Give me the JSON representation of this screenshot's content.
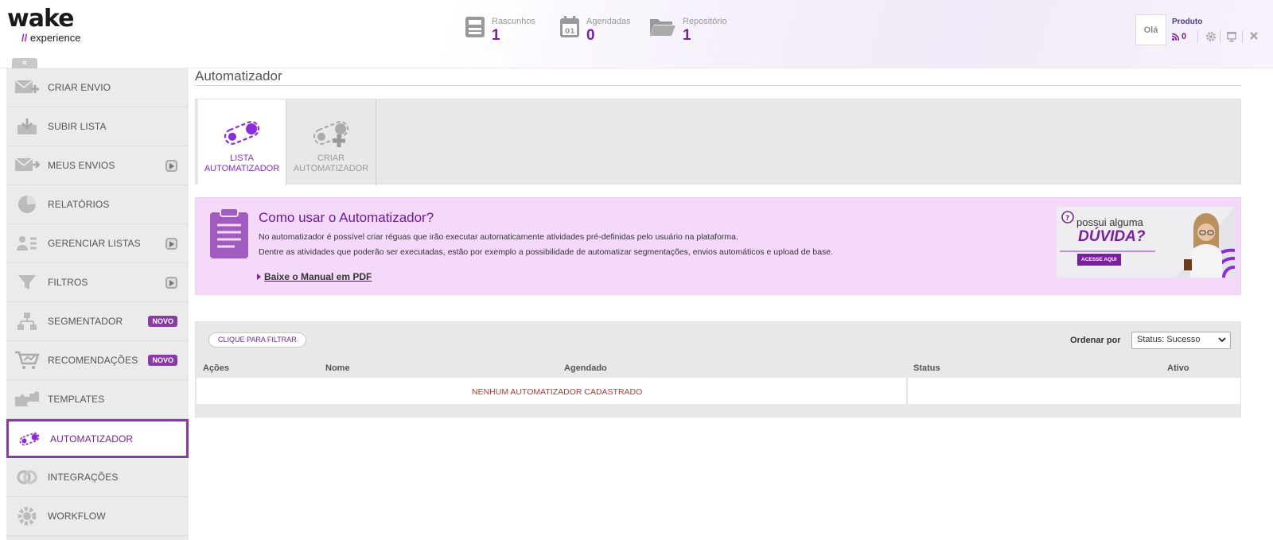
{
  "logo": {
    "word": "wake",
    "sub_slash": "//",
    "sub_text": "experience"
  },
  "header": {
    "stats": [
      {
        "label": "Rascunhos",
        "value": "1",
        "icon": "save-icon"
      },
      {
        "label": "Agendadas",
        "value": "0",
        "icon": "calendar-icon"
      },
      {
        "label": "Repositório",
        "value": "1",
        "icon": "folder-icon"
      }
    ],
    "greeting": "Olá",
    "product_label": "Produto",
    "rss_count": "0"
  },
  "sidebar": {
    "collapse_label": "«",
    "items": [
      {
        "label": "CRIAR ENVIO",
        "icon": "send-plus-icon"
      },
      {
        "label": "SUBIR LISTA",
        "icon": "upload-list-icon"
      },
      {
        "label": "MEUS ENVIOS",
        "icon": "my-sends-icon"
      },
      {
        "label": "RELATÓRIOS",
        "icon": "pie-chart-icon"
      },
      {
        "label": "GERENCIAR LISTAS",
        "icon": "manage-lists-icon"
      },
      {
        "label": "FILTROS",
        "icon": "funnel-icon"
      },
      {
        "label": "SEGMENTADOR",
        "icon": "hierarchy-icon",
        "badge": "NOVO"
      },
      {
        "label": "RECOMENDAÇÕES",
        "icon": "cart-icon",
        "badge": "NOVO"
      },
      {
        "label": "TEMPLATES",
        "icon": "puzzle-icon"
      },
      {
        "label": "AUTOMATIZADOR",
        "icon": "automation-icon",
        "active": true
      },
      {
        "label": "INTEGRAÇÕES",
        "icon": "integration-icon"
      },
      {
        "label": "WORKFLOW",
        "icon": "gear-icon"
      }
    ]
  },
  "page": {
    "title": "Automatizador"
  },
  "tabs": [
    {
      "line1": "LISTA",
      "line2": "AUTOMATIZADOR",
      "active": true
    },
    {
      "line1": "CRIAR",
      "line2": "AUTOMATIZADOR",
      "active": false
    }
  ],
  "info": {
    "title": "Como usar o Automatizador?",
    "line1": "No automatizador é possível criar réguas que irão executar automaticamente atividades pré-definidas pelo usuário na plataforma.",
    "line2": "Dentre as atividades que poderão ser executadas, estão por exemplo a possibilidade de automatizar segmentações, envios automáticos e upload de base.",
    "link": "Baixe o Manual em PDF",
    "banner": {
      "top": "possui alguma",
      "big": "DÚVIDA?",
      "button": "ACESSE AQUI"
    }
  },
  "list": {
    "filter_button": "CLIQUE PARA FILTRAR",
    "order_label": "Ordenar por",
    "order_value": "Status: Sucesso",
    "columns": [
      "Ações",
      "Nome",
      "Agendado",
      "Status",
      "Ativo"
    ],
    "empty_message": "NENHUM AUTOMATIZADOR CADASTRADO"
  },
  "colors": {
    "accent": "#7a1fa2",
    "info_bg": "#f4d9fb",
    "badge": "#8a3aa8"
  }
}
